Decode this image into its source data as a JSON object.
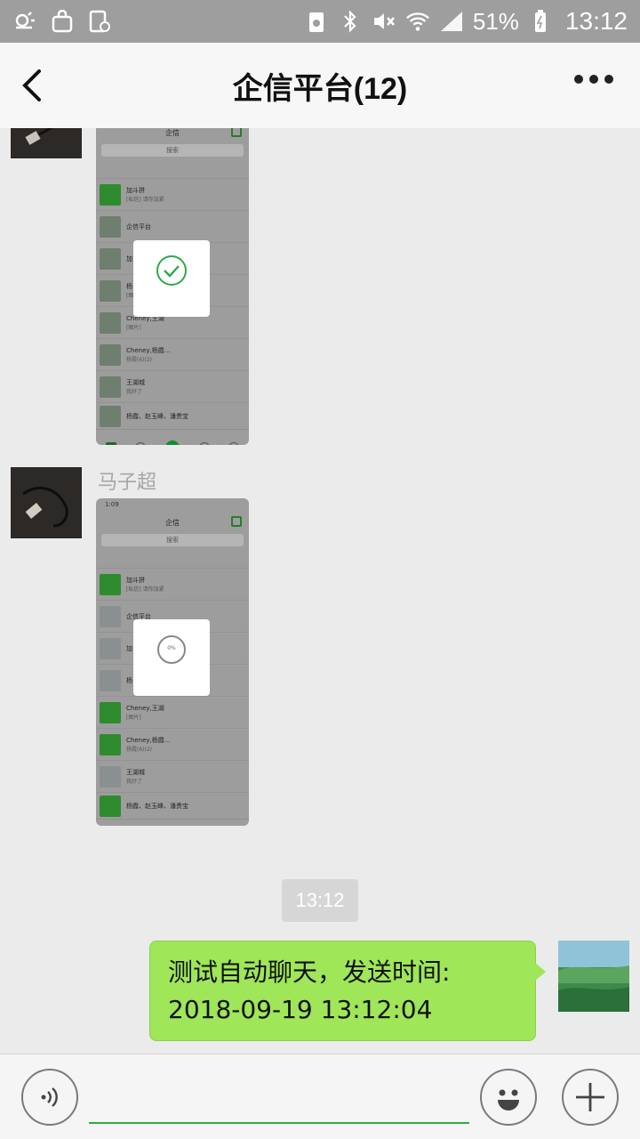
{
  "status_bar": {
    "battery_percent": "51%",
    "time": "13:12",
    "icons": [
      "weather-icon",
      "bag-icon",
      "screenshot-icon",
      "recycle-icon",
      "bluetooth-icon",
      "mute-icon",
      "wifi-icon",
      "signal-icon",
      "battery-icon"
    ]
  },
  "nav": {
    "title": "企信平台(12)",
    "back_icon": "chevron-left-icon",
    "more_icon": "more-dots-icon"
  },
  "messages": [
    {
      "type": "image",
      "direction": "incoming",
      "sender": "",
      "screenshot": {
        "header": "企信",
        "search": "搜索",
        "toast_icon": "check-circle-icon",
        "rows": [
          {
            "name": "加斗拼",
            "sub": "[私信] 请你加紧"
          },
          {
            "name": "企信平台",
            "sub": ""
          },
          {
            "name": "加",
            "sub": ""
          },
          {
            "name": "杨",
            "sub": "[图"
          },
          {
            "name": "Cheney,王湖",
            "sub": "[图片]"
          },
          {
            "name": "Cheney,杨霞...",
            "sub": "杨霞(6)(2)"
          },
          {
            "name": "王湖城",
            "sub": "我好了"
          },
          {
            "name": "杨霞、赵玉峰、潘贵宝",
            "sub": ""
          }
        ]
      }
    },
    {
      "type": "image",
      "direction": "incoming",
      "sender": "马子超",
      "screenshot": {
        "time": "1:09",
        "header": "企信",
        "search": "搜索",
        "toast_icon": "progress-circle-icon",
        "toast_value": "0%",
        "rows": [
          {
            "name": "加斗拼",
            "sub": "[私信] 请你加紧"
          },
          {
            "name": "企信平台",
            "sub": ""
          },
          {
            "name": "加",
            "sub": ""
          },
          {
            "name": "杨",
            "sub": ""
          },
          {
            "name": "Cheney,王湖",
            "sub": "[图片]"
          },
          {
            "name": "Cheney,杨霞...",
            "sub": "杨霞(6)(2)"
          },
          {
            "name": "王湖城",
            "sub": "我好了"
          },
          {
            "name": "杨霞、赵玉峰、潘贵宝",
            "sub": ""
          }
        ]
      }
    },
    {
      "type": "time",
      "text": "13:12"
    },
    {
      "type": "text",
      "direction": "outgoing",
      "line1": "测试自动聊天，发送时间:",
      "line2": "2018-09-19 13:12:04"
    }
  ],
  "input_bar": {
    "voice_icon": "voice-icon",
    "emoji_icon": "emoji-icon",
    "plus_icon": "plus-icon",
    "text_value": "",
    "accent_color": "#27b03c"
  },
  "colors": {
    "bubble_outgoing": "#9fe658",
    "chat_background": "#ebebeb",
    "status_bar": "#9e9e9e"
  }
}
